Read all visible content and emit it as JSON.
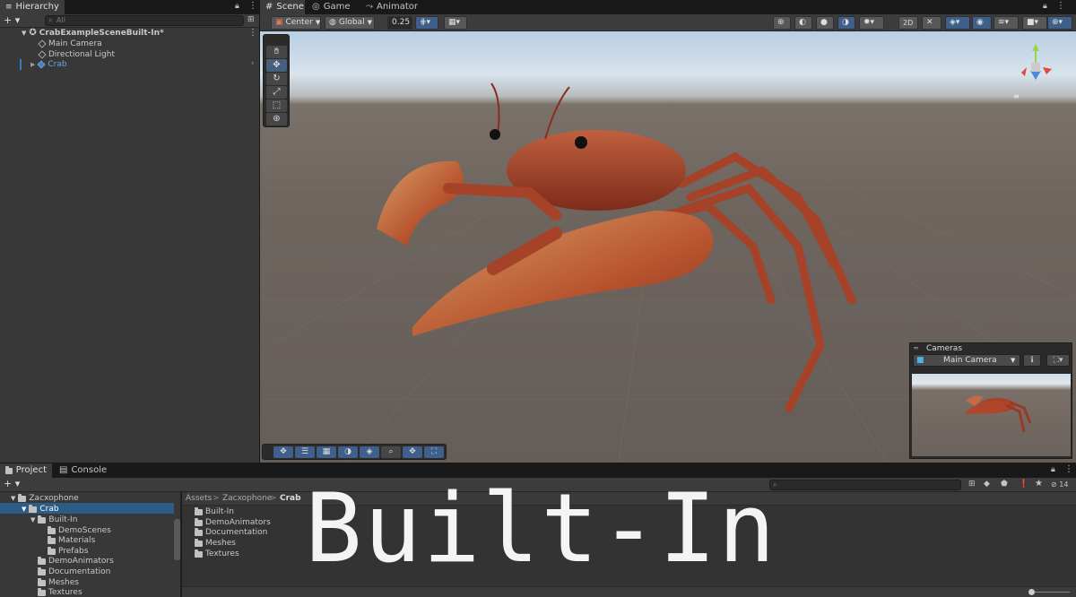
{
  "hierarchy": {
    "tab_label": "Hierarchy",
    "search_placeholder": "All",
    "add_label": "+ ▾",
    "items": [
      {
        "label": "CrabExampleSceneBuilt-In*"
      },
      {
        "label": "Main Camera"
      },
      {
        "label": "Directional Light"
      },
      {
        "label": "Crab"
      }
    ]
  },
  "scene_tabs": [
    {
      "label": "Scene"
    },
    {
      "label": "Game"
    },
    {
      "label": "Animator"
    }
  ],
  "scene_toolbar": {
    "pivot_label": "Center",
    "space_label": "Global",
    "snap_value": "0.25"
  },
  "cameras_overlay": {
    "title": "Cameras",
    "selected_camera": "Main Camera"
  },
  "project": {
    "tabs": [
      {
        "label": "Project"
      },
      {
        "label": "Console"
      }
    ],
    "add_label": "+ ▾",
    "hidden_count": "14",
    "tree": [
      {
        "label": "Zacxophone"
      },
      {
        "label": "Crab"
      },
      {
        "label": "Built-In"
      },
      {
        "label": "DemoScenes"
      },
      {
        "label": "Materials"
      },
      {
        "label": "Prefabs"
      },
      {
        "label": "DemoAnimators"
      },
      {
        "label": "Documentation"
      },
      {
        "label": "Meshes"
      },
      {
        "label": "Textures"
      }
    ],
    "breadcrumb": [
      "Assets",
      "Zacxophone",
      "Crab"
    ],
    "breadcrumb_sep": ">",
    "content": [
      {
        "label": "Built-In"
      },
      {
        "label": "DemoAnimators"
      },
      {
        "label": "Documentation"
      },
      {
        "label": "Meshes"
      },
      {
        "label": "Textures"
      }
    ]
  },
  "overlay_title": "Built-In",
  "colors": {
    "selection_blue": "#2c5d87",
    "accent_blue": "#3e5f8a",
    "crab_red": "#b0452c"
  }
}
